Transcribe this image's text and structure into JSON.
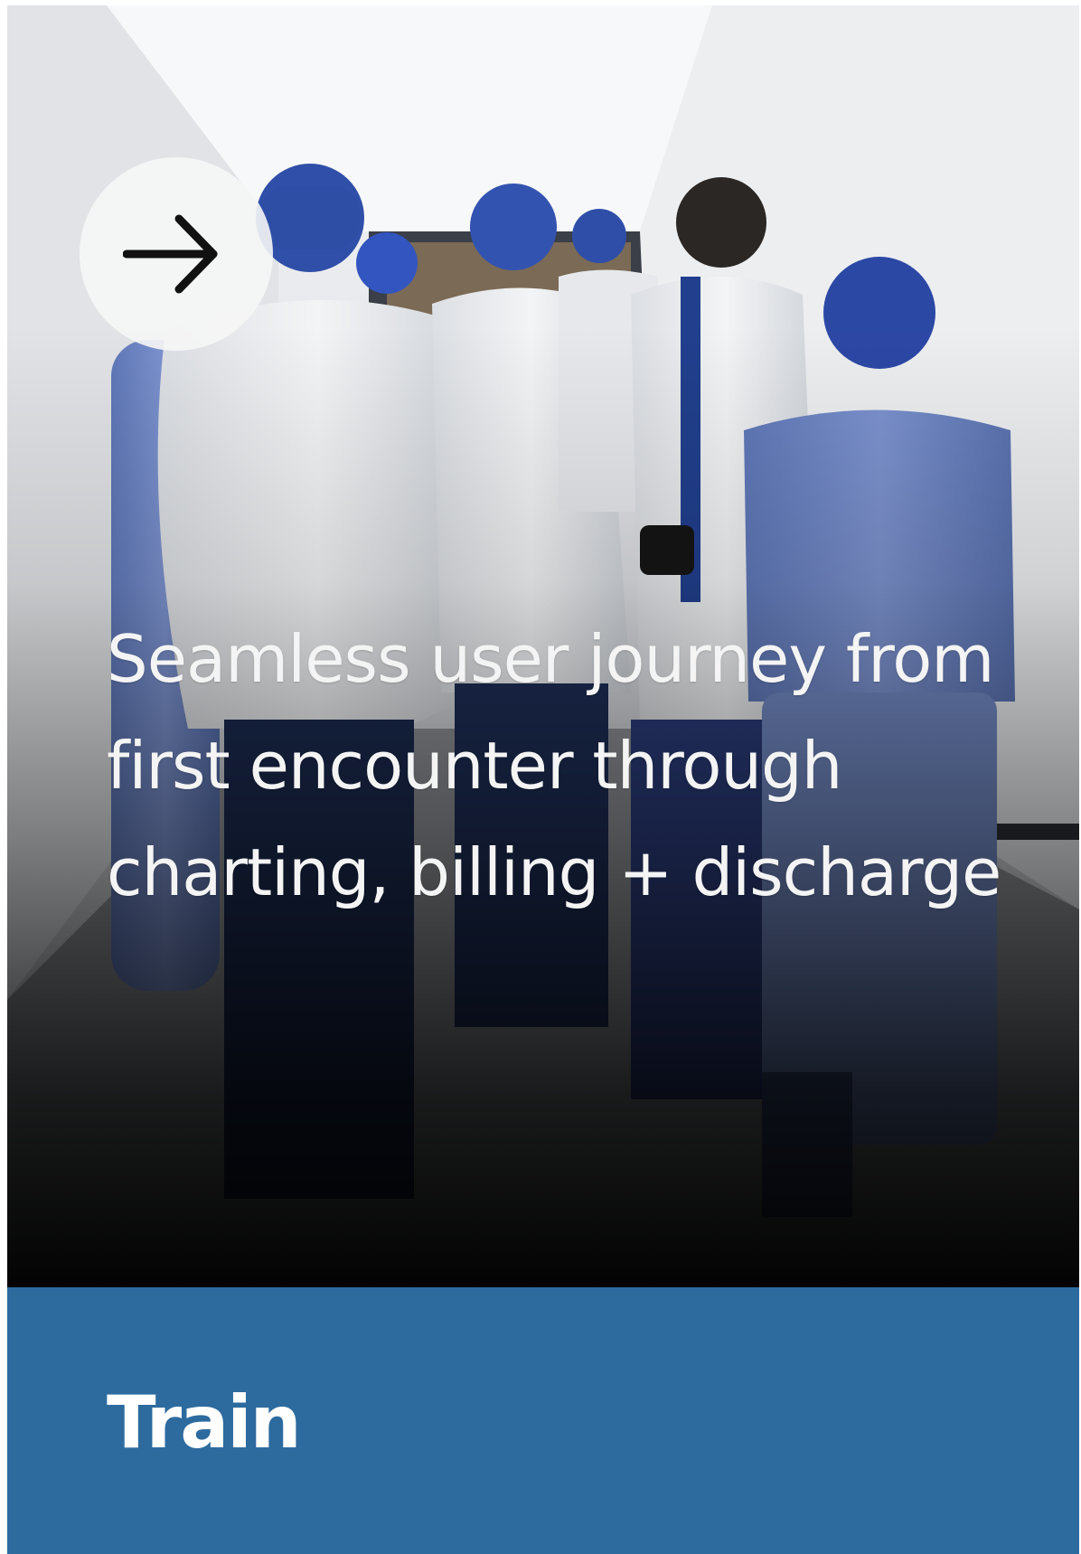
{
  "card": {
    "photo_alt": "Medical staff in scrubs and white coats walking down a hospital corridor",
    "headline": "Seamless user journey from first encounter through charting, billing + discharge",
    "label": "Train",
    "arrow_icon": "arrow-right-icon"
  },
  "colors": {
    "footer_background": "#2d6b9f",
    "headline_text": "#f4f4f4",
    "label_text": "#ffffff",
    "arrow_button_background": "#f6f6f6",
    "arrow": "#111111"
  }
}
